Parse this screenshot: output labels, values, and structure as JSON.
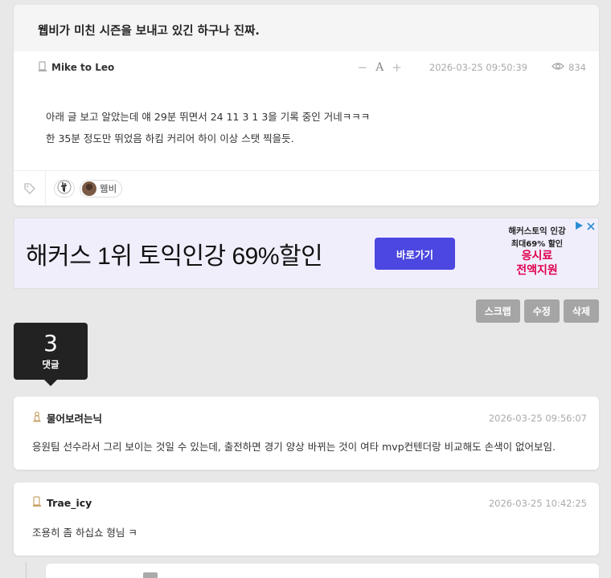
{
  "post": {
    "title": "웹비가 미친 시즌을 보내고 있긴 하구나 진짜.",
    "author": "Mike to Leo",
    "font_controls": {
      "minus": "−",
      "letter": "A",
      "plus": "+"
    },
    "date": "2026-03-25 09:50:39",
    "views": "834",
    "body": [
      "아래 글 보고 알았는데 얘 29분 뛰면서 24 11 3 1 3을 기록 중인 거네ㅋㅋㅋ",
      "한 35분 정도만 뛰었음 하킴 커리어 하이 이상 스탯 찍을듯."
    ],
    "tags": [
      {
        "icon": "spurs-logo-icon",
        "label": ""
      },
      {
        "icon": "player-avatar-icon",
        "label": "웸비"
      }
    ]
  },
  "ad": {
    "headline": "해커스 1위 토익인강 69%할인",
    "cta": "바로가기",
    "promo_line1": "해커스토익 인강",
    "promo_line2": "최대69% 할인",
    "promo_line3": "응시료",
    "promo_line4": "전액지원",
    "accent_color": "#4b47e0"
  },
  "actions": {
    "scrap": "스크랩",
    "edit": "수정",
    "delete": "삭제"
  },
  "comment_summary": {
    "count": "3",
    "label": "댓글"
  },
  "comments": [
    {
      "author": "물어보려는닉",
      "date": "2026-03-25 09:56:07",
      "body": "응원팀 선수라서 그리 보이는 것일 수 있는데, 출전하면 경기 양상 바뀌는 것이 여타 mvp컨텐더랑 비교해도 손색이 없어보임."
    },
    {
      "author": "Trae_icy",
      "date": "2026-03-25 10:42:25",
      "body": "조용히 좀 하십쇼 형님 ㅋ"
    }
  ]
}
